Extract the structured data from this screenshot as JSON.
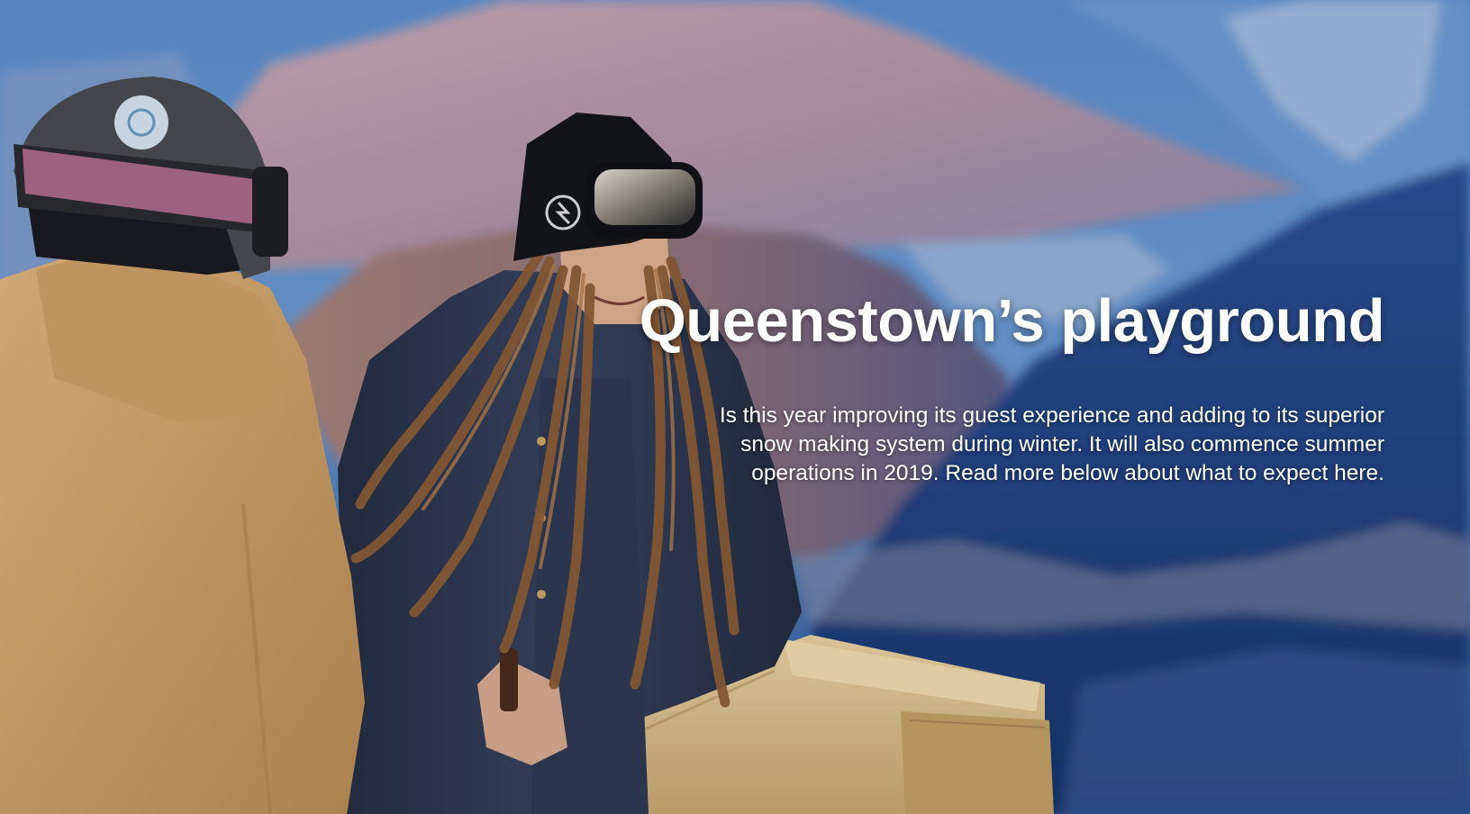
{
  "hero": {
    "title": "Queenstown’s playground",
    "body": "Is this year improving its guest experience and adding to its superior snow making system during winter. It will also commence summer operations in 2019. Read more below about what to expect here."
  },
  "colors": {
    "sky": "#4f86c8",
    "mountain_far": "#b49aa6",
    "mountain_near": "#1f3f7a",
    "hoodie": "#d2a468",
    "jacket": "#2c3548",
    "dreadlocks": "#8a5a30",
    "timber": "#d9bd86",
    "text": "#ffffff"
  },
  "icons": [
    "helmet-icon",
    "goggles-icon",
    "beanie-icon",
    "bottle-icon"
  ]
}
